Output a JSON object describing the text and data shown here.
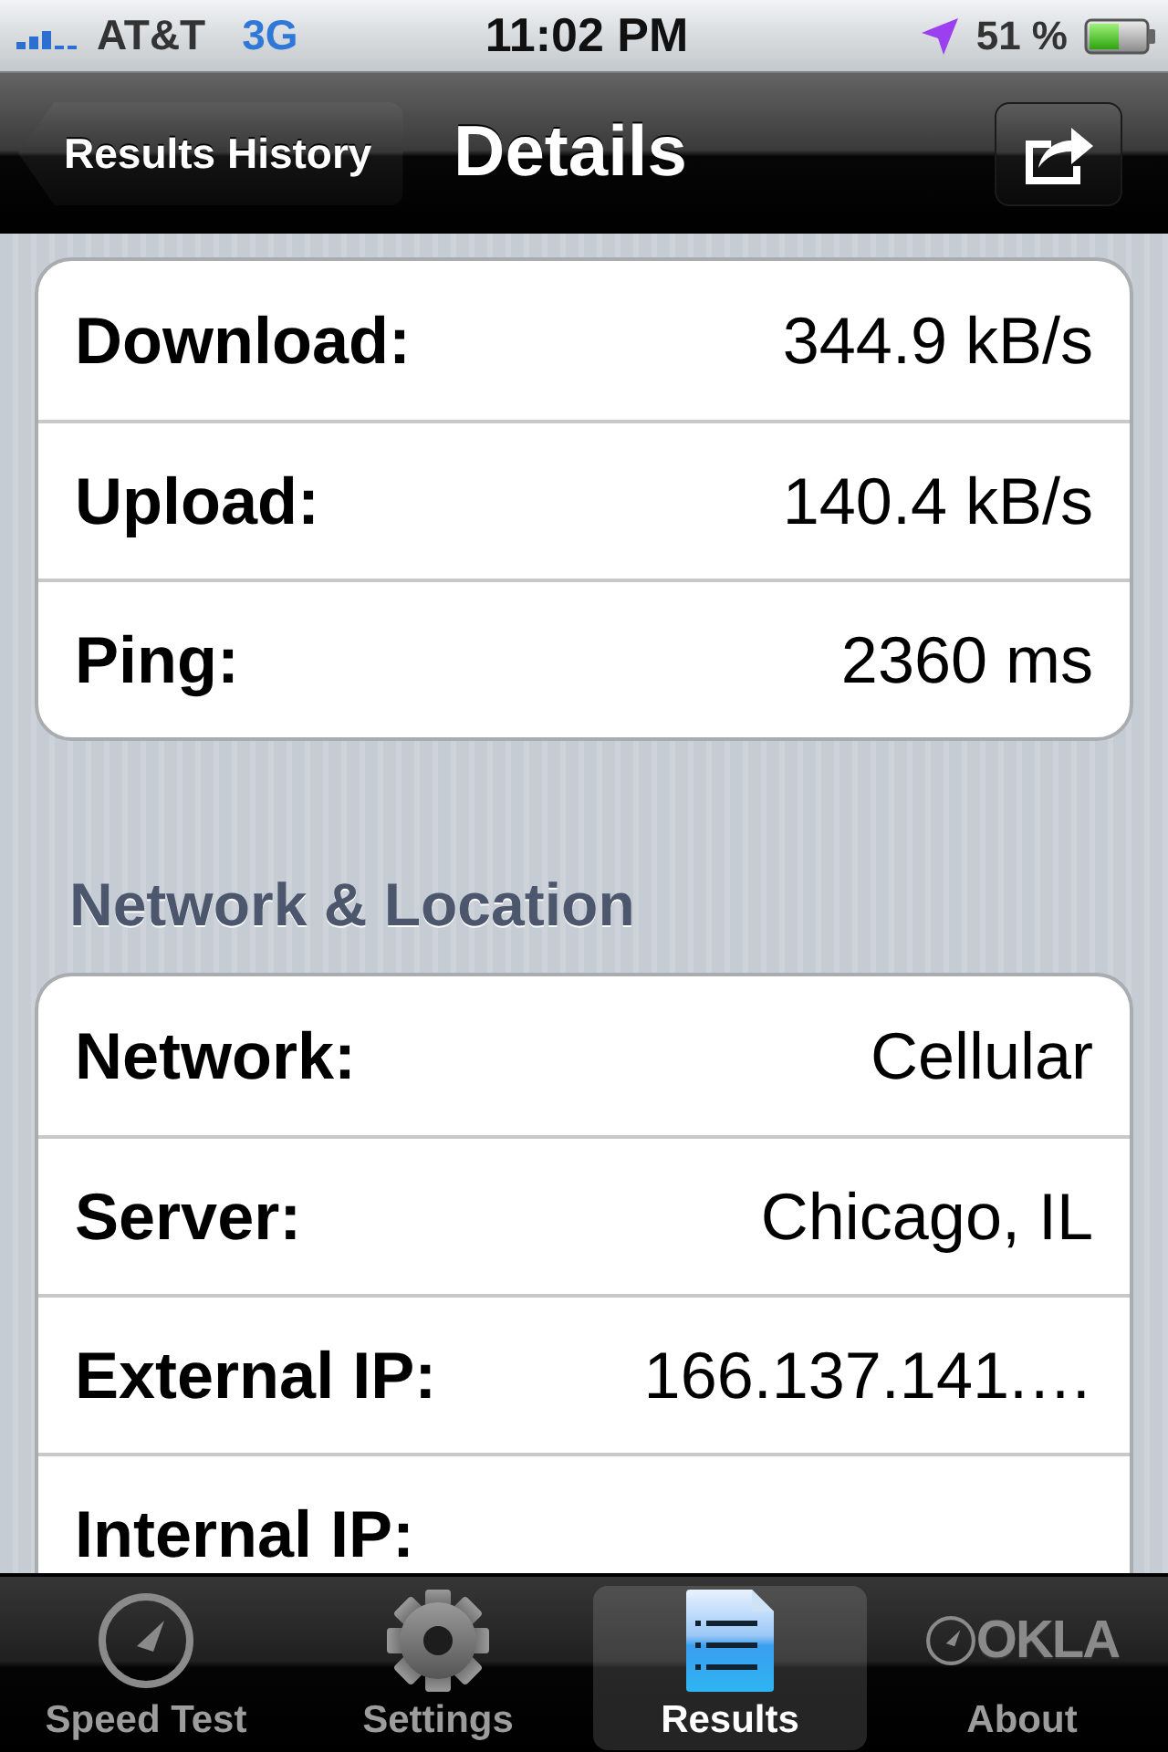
{
  "status_bar": {
    "carrier": "AT&T",
    "network": "3G",
    "time": "11:02 PM",
    "battery": "51 %"
  },
  "nav_bar": {
    "back_button": "Results History",
    "title": "Details"
  },
  "sections": [
    {
      "rows": [
        {
          "label": "Download:",
          "value": "344.9 kB/s"
        },
        {
          "label": "Upload:",
          "value": "140.4 kB/s"
        },
        {
          "label": "Ping:",
          "value": "2360 ms"
        }
      ]
    },
    {
      "header": "Network & Location",
      "rows": [
        {
          "label": "Network:",
          "value": "Cellular"
        },
        {
          "label": "Server:",
          "value": "Chicago, IL"
        },
        {
          "label": "External IP:",
          "value": "166.137.141.…"
        },
        {
          "label": "Internal IP:"
        }
      ]
    }
  ],
  "tab_bar": [
    {
      "kind": "gauge",
      "label": "Speed Test",
      "selected": false
    },
    {
      "kind": "gear",
      "label": "Settings",
      "selected": false
    },
    {
      "kind": "document",
      "label": "Results",
      "selected": true
    },
    {
      "kind": "logo",
      "logo_text": "OKLA",
      "label": "About",
      "selected": false
    }
  ]
}
